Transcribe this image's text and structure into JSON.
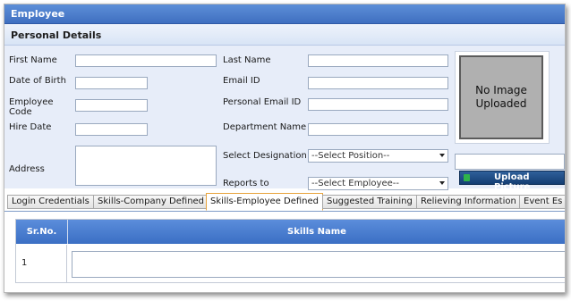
{
  "window": {
    "title": "Employee"
  },
  "section": {
    "title": "Personal Details"
  },
  "form": {
    "first_name": {
      "label": "First Name",
      "value": ""
    },
    "last_name": {
      "label": "Last Name",
      "value": ""
    },
    "date_of_birth": {
      "label": "Date of Birth",
      "value": ""
    },
    "email_id": {
      "label": "Email ID",
      "value": ""
    },
    "employee_code": {
      "label_line1": "Employee",
      "label_line2": "Code",
      "value": ""
    },
    "personal_email": {
      "label": "Personal Email ID",
      "value": ""
    },
    "hire_date": {
      "label": "Hire Date",
      "value": ""
    },
    "department": {
      "label": "Department Name",
      "value": ""
    },
    "address": {
      "label": "Address",
      "value": ""
    },
    "designation": {
      "label": "Select Designation",
      "selected": "--Select Position--"
    },
    "reports_to": {
      "label": "Reports to",
      "selected": "--Select Employee--"
    }
  },
  "photo": {
    "line1": "No Image",
    "line2": "Uploaded",
    "upload_label": "Upload Picture"
  },
  "tabs": [
    {
      "label": "Login Credentials"
    },
    {
      "label": "Skills-Company Defined"
    },
    {
      "label": "Skills-Employee Defined",
      "active": true
    },
    {
      "label": "Suggested Training"
    },
    {
      "label": "Relieving Information"
    },
    {
      "label": "Event Es"
    }
  ],
  "grid": {
    "columns": [
      "Sr.No.",
      "Skills Name"
    ],
    "rows": [
      {
        "sr": "1",
        "skill": ""
      }
    ]
  },
  "colors": {
    "header": "#3f6fc0",
    "accent_tab": "#e8a33b",
    "form_bg": "#e7edf9"
  }
}
